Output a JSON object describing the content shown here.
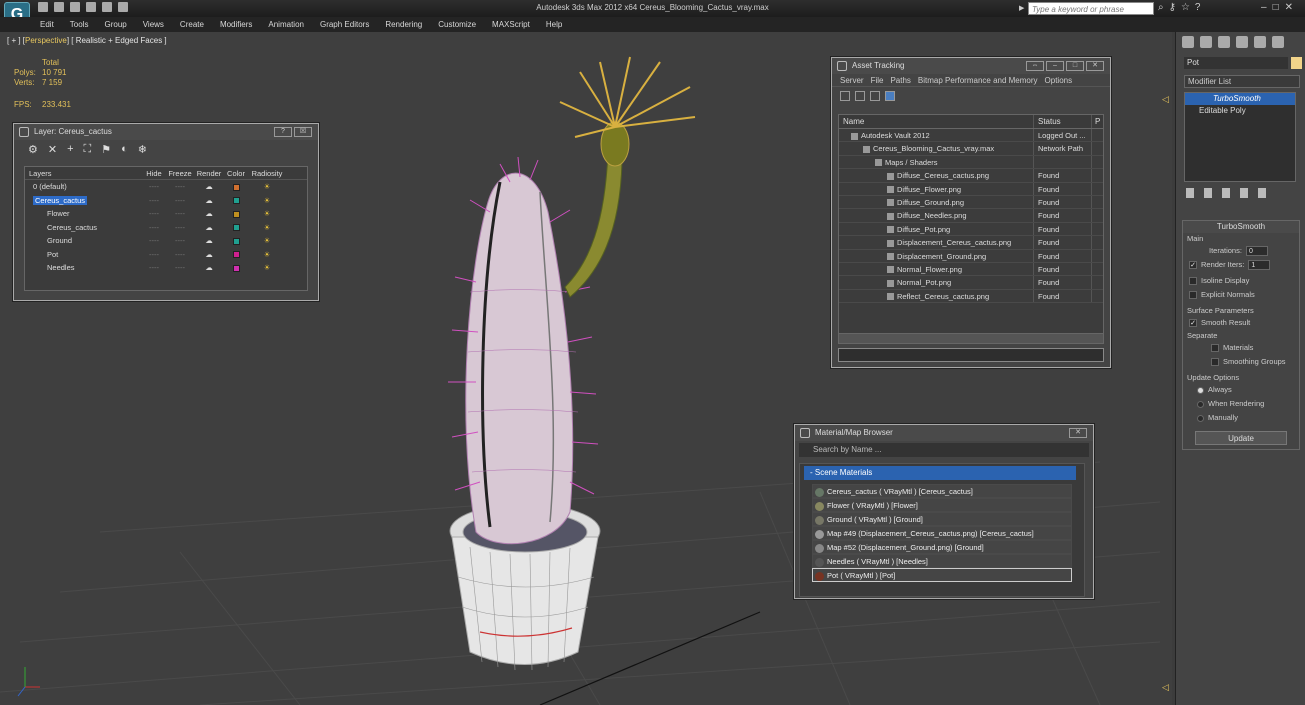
{
  "app": {
    "title": "Autodesk 3ds Max  2012 x64     Cereus_Blooming_Cactus_vray.max",
    "logo": "G",
    "search_placeholder": "Type a keyword or phrase"
  },
  "menu": [
    "Edit",
    "Tools",
    "Group",
    "Views",
    "Create",
    "Modifiers",
    "Animation",
    "Graph Editors",
    "Rendering",
    "Customize",
    "MAXScript",
    "Help"
  ],
  "viewport": {
    "label_prefix": "[ + ] [",
    "label_mode": "Perspective",
    "label_suffix": "] [ Realistic + Edged Faces ]",
    "stats": {
      "total_label": "Total",
      "polys_label": "Polys:",
      "polys": "10 791",
      "verts_label": "Verts:",
      "verts": "7 159",
      "fps_label": "FPS:",
      "fps": "233.431"
    }
  },
  "layer_panel": {
    "title": "Layer: Cereus_cactus",
    "btn_help": "?",
    "btn_close": "☒",
    "columns": [
      "Layers",
      "Hide",
      "Freeze",
      "Render",
      "Color",
      "Radiosity"
    ],
    "rows": [
      {
        "name": "0 (default)",
        "color": "#d07030",
        "indent": 0,
        "selected": false
      },
      {
        "name": "Cereus_cactus",
        "color": "#20a090",
        "indent": 0,
        "selected": true
      },
      {
        "name": "Flower",
        "color": "#c09020",
        "indent": 1,
        "selected": false
      },
      {
        "name": "Cereus_cactus",
        "color": "#20a090",
        "indent": 1,
        "selected": false
      },
      {
        "name": "Ground",
        "color": "#20a090",
        "indent": 1,
        "selected": false
      },
      {
        "name": "Pot",
        "color": "#d02090",
        "indent": 1,
        "selected": false
      },
      {
        "name": "Needles",
        "color": "#d030b0",
        "indent": 1,
        "selected": false
      }
    ],
    "dash": "----",
    "render_glyph": "☁",
    "radiosity_glyph": "☀"
  },
  "asset_panel": {
    "title": "Asset Tracking",
    "menu": [
      "Server",
      "File",
      "Paths",
      "Bitmap Performance and Memory",
      "Options"
    ],
    "columns": [
      "Name",
      "Status",
      "P"
    ],
    "rows": [
      {
        "name": "Autodesk Vault 2012",
        "status": "Logged Out ...",
        "indent": 1
      },
      {
        "name": "Cereus_Blooming_Cactus_vray.max",
        "status": "Network Path",
        "indent": 2
      },
      {
        "name": "Maps / Shaders",
        "status": "",
        "indent": 3
      },
      {
        "name": "Diffuse_Cereus_cactus.png",
        "status": "Found",
        "indent": 4
      },
      {
        "name": "Diffuse_Flower.png",
        "status": "Found",
        "indent": 4
      },
      {
        "name": "Diffuse_Ground.png",
        "status": "Found",
        "indent": 4
      },
      {
        "name": "Diffuse_Needles.png",
        "status": "Found",
        "indent": 4
      },
      {
        "name": "Diffuse_Pot.png",
        "status": "Found",
        "indent": 4
      },
      {
        "name": "Displacement_Cereus_cactus.png",
        "status": "Found",
        "indent": 4
      },
      {
        "name": "Displacement_Ground.png",
        "status": "Found",
        "indent": 4
      },
      {
        "name": "Normal_Flower.png",
        "status": "Found",
        "indent": 4
      },
      {
        "name": "Normal_Pot.png",
        "status": "Found",
        "indent": 4
      },
      {
        "name": "Reflect_Cereus_cactus.png",
        "status": "Found",
        "indent": 4
      }
    ]
  },
  "material_panel": {
    "title": "Material/Map Browser",
    "search_placeholder": "Search by Name ...",
    "section": "- Scene Materials",
    "rows": [
      {
        "label": "Cereus_cactus  ( VRayMtl ) [Cereus_cactus]",
        "color": "#667766"
      },
      {
        "label": "Flower  ( VRayMtl ) [Flower]",
        "color": "#888860"
      },
      {
        "label": "Ground  ( VRayMtl ) [Ground]",
        "color": "#777766"
      },
      {
        "label": "Map #49 (Displacement_Cereus_cactus.png) [Cereus_cactus]",
        "color": "#999999"
      },
      {
        "label": "Map #52 (Displacement_Ground.png) [Ground]",
        "color": "#888888"
      },
      {
        "label": "Needles  ( VRayMtl ) [Needles]",
        "color": "#555555"
      },
      {
        "label": "Pot  ( VRayMtl ) [Pot]",
        "color": "#773322"
      }
    ]
  },
  "command_panel": {
    "object_name": "Pot",
    "modifier_list": "Modifier List",
    "stack": [
      "TurboSmooth",
      "Editable Poly"
    ],
    "rollout_title": "TurboSmooth",
    "main_label": "Main",
    "iterations_label": "Iterations:",
    "iterations": "0",
    "render_iters_label": "Render Iters:",
    "render_iters": "1",
    "isoline": "Isoline Display",
    "explicit_normals": "Explicit Normals",
    "surface_label": "Surface Parameters",
    "smooth_result": "Smooth Result",
    "separate_label": "Separate",
    "materials": "Materials",
    "smoothing_groups": "Smoothing Groups",
    "update_options_label": "Update Options",
    "always": "Always",
    "when_rendering": "When Rendering",
    "manually": "Manually",
    "update_button": "Update"
  }
}
